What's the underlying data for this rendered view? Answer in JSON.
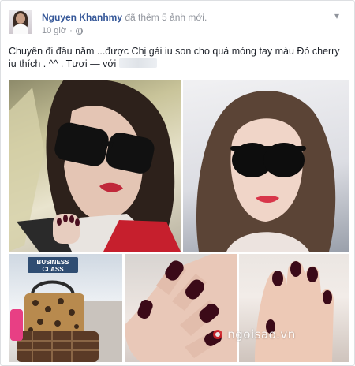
{
  "post": {
    "author": "Nguyen Khanhmy",
    "action": " đã thêm 5 ảnh mới.",
    "time": "10 giờ",
    "caption": "Chuyến đi đầu năm ...được Chị gái iu son cho quả móng tay màu Đỏ cherry iu thích . ^^ . Tươi — với",
    "tagged": ""
  },
  "photos": {
    "p3_sign": "BUSINESS CLASS"
  },
  "watermark": "ngoisao.vn",
  "colors": {
    "link": "#365899",
    "meta": "#90949c",
    "nail": "#4a0e1e",
    "lips": "#c0283a"
  }
}
